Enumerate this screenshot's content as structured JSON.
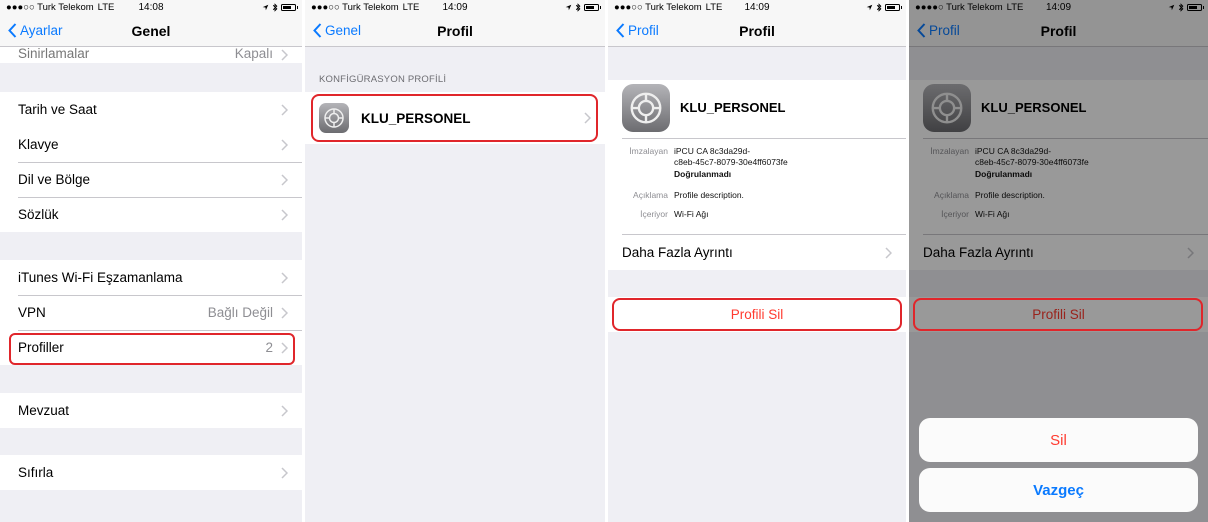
{
  "status": {
    "carrier1": "●●●○○ Turk Telekom",
    "carrier4": "●●●●○ Turk Telekom",
    "network": "LTE",
    "time1": "14:08",
    "time2": "14:09",
    "time3": "14:09",
    "time4": "14:09"
  },
  "screen1": {
    "back": "Ayarlar",
    "title": "Genel",
    "cut_row": {
      "label": "Sinirlamalar",
      "detail": "Kapalı"
    },
    "rows_group1": [
      {
        "label": "Tarih ve Saat"
      },
      {
        "label": "Klavye"
      },
      {
        "label": "Dil ve Bölge"
      },
      {
        "label": "Sözlük"
      }
    ],
    "rows_group2": [
      {
        "label": "iTunes Wi-Fi Eşzamanlama",
        "detail": ""
      },
      {
        "label": "VPN",
        "detail": "Bağlı Değil"
      },
      {
        "label": "Profiller",
        "detail": "2"
      }
    ],
    "row_mevzuat": "Mevzuat",
    "row_sifirla": "Sıfırla"
  },
  "screen2": {
    "back": "Genel",
    "title": "Profil",
    "section_header": "KONFİGÜRASYON PROFİLİ",
    "profile_name": "KLU_PERSONEL"
  },
  "screen3": {
    "back": "Profil",
    "title": "Profil",
    "profile_name": "KLU_PERSONEL",
    "signed_by_key": "İmzalayan",
    "signed_by_line1": "iPCU CA 8c3da29d-",
    "signed_by_line2": "c8eb-45c7-8079-30e4ff6073fe",
    "unverified": "Doğrulanmadı",
    "description_key": "Açıklama",
    "description_value": "Profile description.",
    "contains_key": "İçeriyor",
    "contains_value": "Wi-Fi Ağı",
    "more_details": "Daha Fazla Ayrıntı",
    "delete_button": "Profili Sil"
  },
  "screen4": {
    "back": "Profil",
    "title": "Profil",
    "profile_name": "KLU_PERSONEL",
    "signed_by_key": "İmzalayan",
    "signed_by_line1": "iPCU CA 8c3da29d-",
    "signed_by_line2": "c8eb-45c7-8079-30e4ff6073fe",
    "unverified": "Doğrulanmadı",
    "description_key": "Açıklama",
    "description_value": "Profile description.",
    "contains_key": "İçeriyor",
    "contains_value": "Wi-Fi Ağı",
    "more_details": "Daha Fazla Ayrıntı",
    "delete_button": "Profili Sil",
    "sheet_delete": "Sil",
    "sheet_cancel": "Vazgeç"
  },
  "colors": {
    "ios_blue": "#0a7aff",
    "destructive_red": "#ff3b30",
    "highlight_red": "#e0262b",
    "grouped_bg": "#efeff4"
  },
  "icons": [
    "chevron-left-icon",
    "chevron-right-icon",
    "settings-gear-icon",
    "location-arrow-icon",
    "bluetooth-icon",
    "battery-icon"
  ]
}
